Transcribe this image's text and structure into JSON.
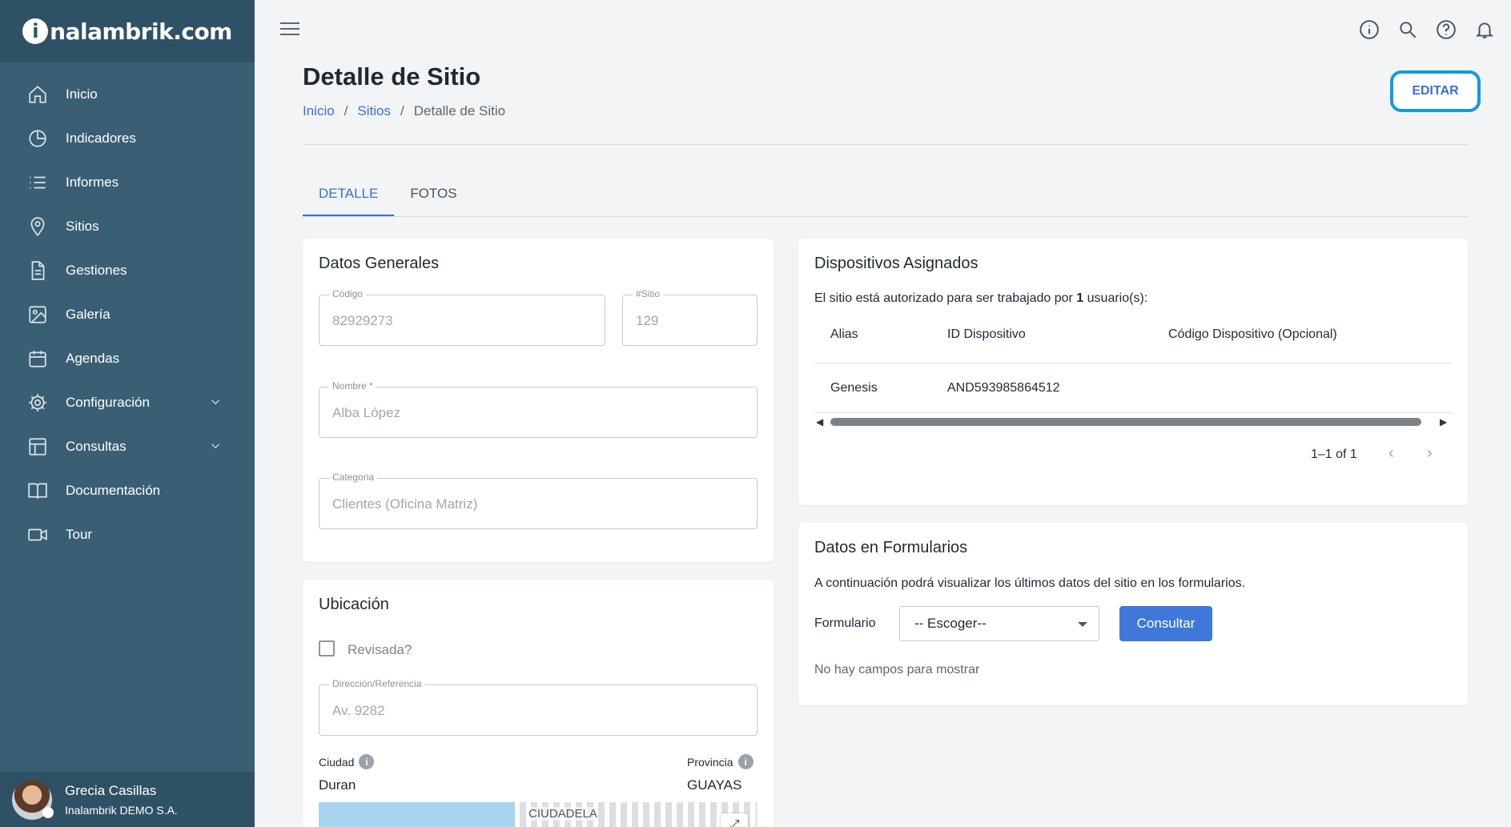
{
  "brand": {
    "logo_letter": "i",
    "logo_text": "nalambrik.com"
  },
  "sidebar": {
    "items": [
      {
        "label": "Inicio",
        "icon": "home-icon"
      },
      {
        "label": "Indicadores",
        "icon": "pie-chart-icon"
      },
      {
        "label": "Informes",
        "icon": "list-icon"
      },
      {
        "label": "Sitios",
        "icon": "location-pin-icon"
      },
      {
        "label": "Gestiones",
        "icon": "document-icon"
      },
      {
        "label": "Galería",
        "icon": "image-icon"
      },
      {
        "label": "Agendas",
        "icon": "calendar-icon"
      },
      {
        "label": "Configuración",
        "icon": "gear-icon"
      },
      {
        "label": "Consultas",
        "icon": "table-icon"
      },
      {
        "label": "Documentación",
        "icon": "book-icon"
      },
      {
        "label": "Tour",
        "icon": "video-icon"
      }
    ],
    "user": {
      "name": "Grecia Casillas",
      "org": "Inalambrik DEMO S.A."
    }
  },
  "header": {
    "title": "Detalle de Sitio",
    "breadcrumb": [
      "Inicio",
      "Sitios",
      "Detalle de Sitio"
    ],
    "edit_label": "EDITAR",
    "separator": "/"
  },
  "tabs": [
    "DETALLE",
    "FOTOS"
  ],
  "datos_generales": {
    "title": "Datos Generales",
    "codigo_label": "Código",
    "codigo_value": "82929273",
    "sitio_label": "#Sitio",
    "sitio_value": "129",
    "nombre_label": "Nombre *",
    "nombre_value": "Alba López",
    "categoria_label": "Categoria",
    "categoria_value": "Clientes (Oficina Matriz)"
  },
  "ubicacion": {
    "title": "Ubicación",
    "revisada_label": "Revisada?",
    "direccion_label": "Dirección/Referencia",
    "direccion_value": "Av. 9282",
    "ciudad_label": "Ciudad",
    "ciudad_value": "Duran",
    "provincia_label": "Provincia",
    "provincia_value": "GUAYAS",
    "map_label": "CIUDADELA"
  },
  "dispositivos": {
    "title": "Dispositivos Asignados",
    "desc_prefix": "El sitio está autorizado para ser trabajado por ",
    "desc_count": "1",
    "desc_suffix": " usuario(s):",
    "columns": [
      "Alias",
      "ID Dispositivo",
      "Código Dispositivo (Opcional)"
    ],
    "rows": [
      {
        "alias": "Genesis",
        "id": "AND593985864512",
        "codigo": ""
      }
    ],
    "pager": "1–1 of 1"
  },
  "formularios": {
    "title": "Datos en Formularios",
    "desc": "A continuación podrá visualizar los últimos datos del sitio en los formularios.",
    "formulario_label": "Formulario",
    "select_value": "-- Escoger--",
    "consultar_label": "Consultar",
    "empty_text": "No hay campos para mostrar"
  }
}
